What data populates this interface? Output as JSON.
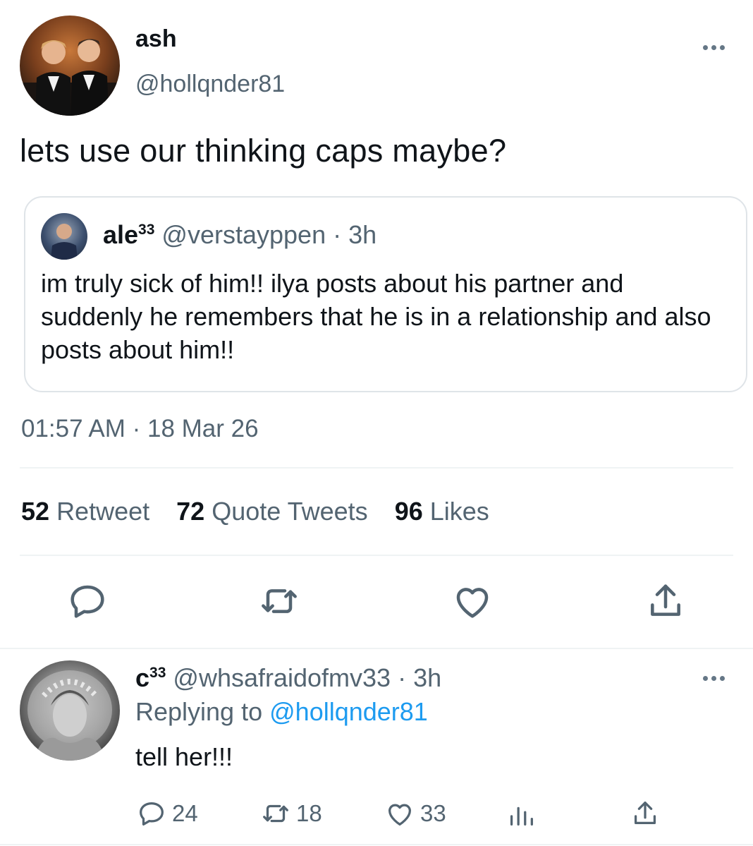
{
  "tweet": {
    "display_name": "ash",
    "handle": "@hollqnder81",
    "text": "lets use our thinking caps maybe?",
    "timestamp": "01:57 AM · 18 Mar 26"
  },
  "quote": {
    "name": "ale",
    "name_sup": "33",
    "handle": "@verstayppen",
    "separator": "·",
    "time": "3h",
    "text": "im truly sick of him!! ilya posts about his partner and suddenly he remembers that he is in a relationship and also posts about him!!"
  },
  "stats": {
    "retweets": "52",
    "retweets_label": "Retweet",
    "quotes": "72",
    "quotes_label": "Quote Tweets",
    "likes": "96",
    "likes_label": "Likes"
  },
  "reply": {
    "name": "c",
    "name_sup": "33",
    "handle": "@whsafraidofmv33",
    "separator": "·",
    "time": "3h",
    "replying_prefix": "Replying to",
    "replying_handle": "@hollqnder81",
    "text": "tell her!!!",
    "counts": {
      "replies": "24",
      "retweets": "18",
      "likes": "33"
    }
  },
  "colors": {
    "text": "#0f1419",
    "muted": "#536471",
    "link": "#1d9bf0",
    "border": "#dfe4e8"
  },
  "icons": [
    "more-icon",
    "reply-icon",
    "retweet-icon",
    "like-icon",
    "share-icon",
    "analytics-icon"
  ]
}
